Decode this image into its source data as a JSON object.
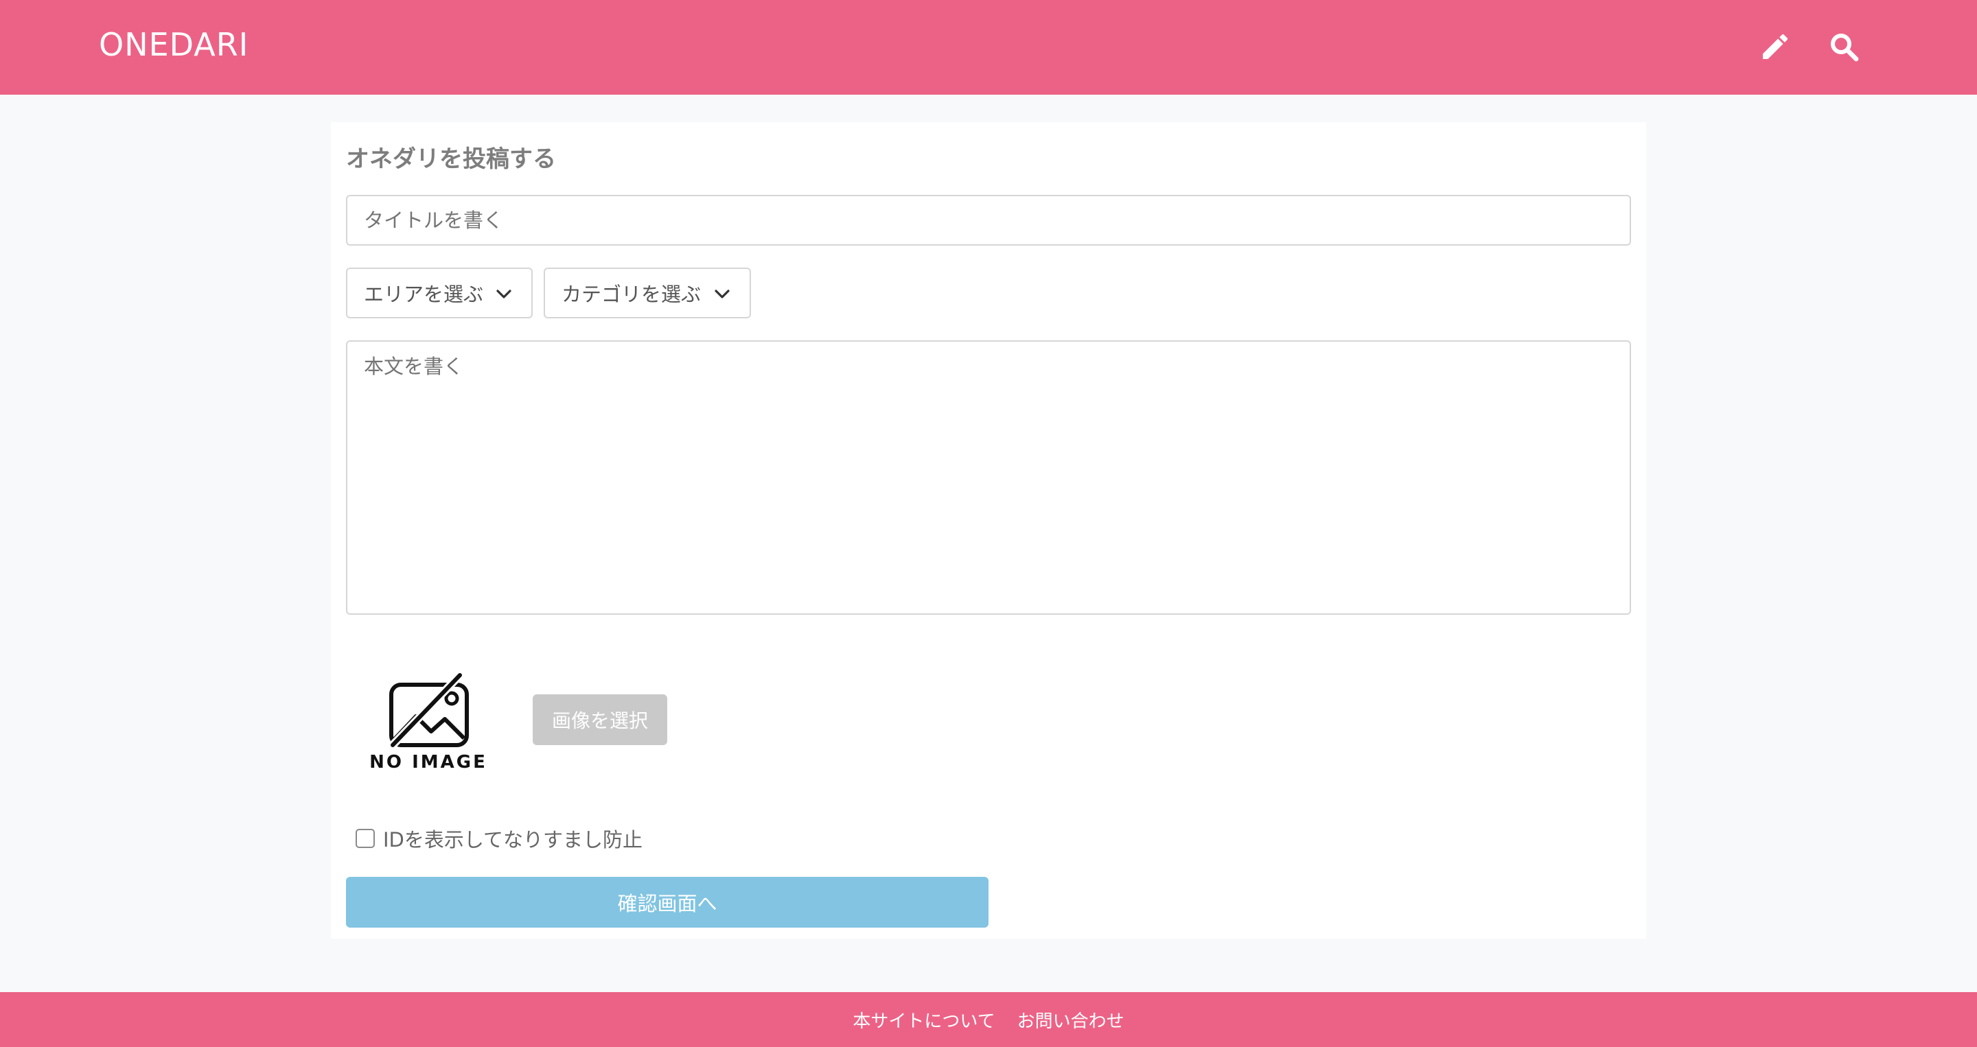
{
  "header": {
    "logo": "ONEDARI",
    "icons": [
      "pencil-icon",
      "search-icon"
    ],
    "color": "#ec6286"
  },
  "form": {
    "page_title": "オネダリを投稿する",
    "title_placeholder": "タイトルを書く",
    "area_select": "エリアを選ぶ",
    "category_select": "カテゴリを選ぶ",
    "body_placeholder": "本文を書く",
    "no_image_text": "NO IMAGE",
    "image_button": "画像を選択",
    "checkbox_label": "IDを表示してなりすまし防止",
    "checkbox_checked": false,
    "confirm_button": "確認画面へ"
  },
  "footer": {
    "links": [
      "本サイトについて",
      "お問い合わせ"
    ]
  },
  "colors": {
    "brand": "#ec6286",
    "confirm": "#82c4e2",
    "disabled_button": "#c9c9c9"
  }
}
